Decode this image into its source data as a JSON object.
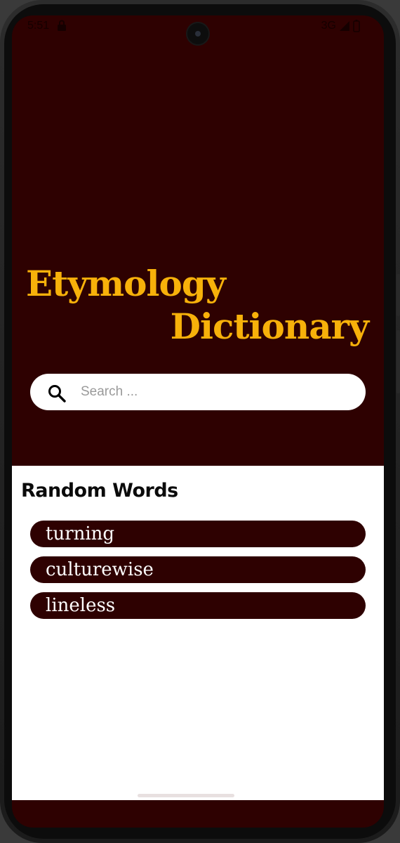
{
  "status_bar": {
    "time": "5:51",
    "network": "3G"
  },
  "app": {
    "title_line1": "Etymology",
    "title_line2": "Dictionary"
  },
  "search": {
    "placeholder": "Search ...",
    "value": ""
  },
  "random_words": {
    "heading": "Random Words",
    "items": [
      {
        "label": "turning"
      },
      {
        "label": "culturewise"
      },
      {
        "label": "lineless"
      }
    ]
  },
  "icons": {
    "search": "search-icon",
    "lock": "lock-icon",
    "signal": "signal-icon",
    "battery": "battery-icon"
  },
  "colors": {
    "primary": "#2e0101",
    "accent": "#f7b10a",
    "surface": "#ffffff"
  }
}
